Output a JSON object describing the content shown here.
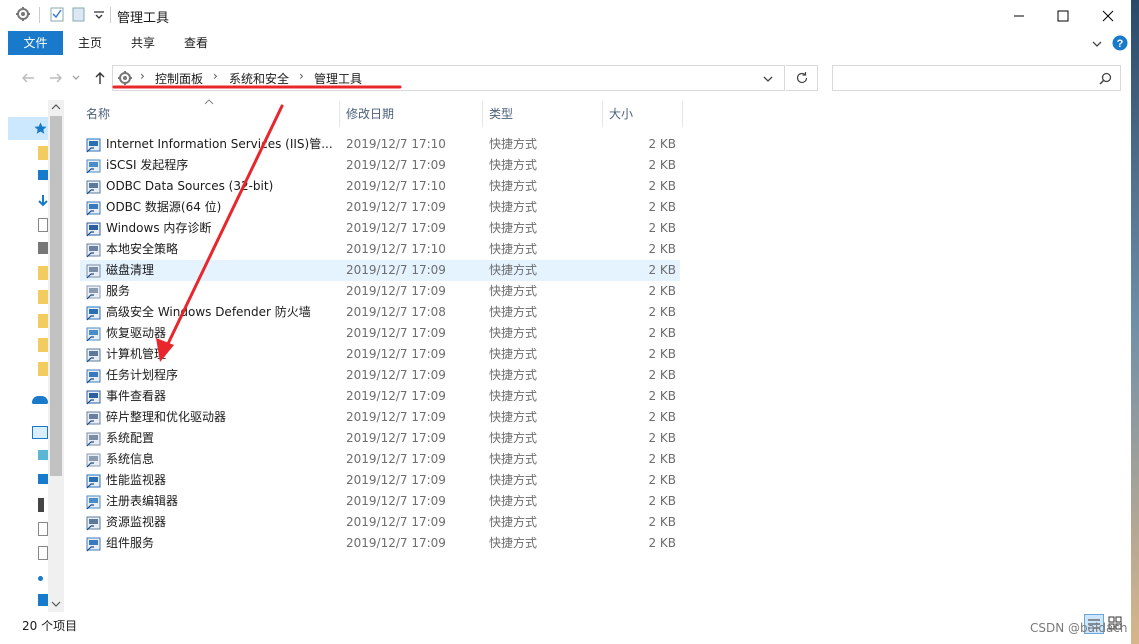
{
  "title_bar": {
    "title": "管理工具"
  },
  "ribbon": {
    "tabs": [
      "文件",
      "主页",
      "共享",
      "查看"
    ]
  },
  "address_bar": {
    "crumbs": [
      "控制面板",
      "系统和安全",
      "管理工具"
    ]
  },
  "search": {
    "placeholder": ""
  },
  "columns": {
    "name": "名称",
    "date": "修改日期",
    "type": "类型",
    "size": "大小"
  },
  "files": [
    {
      "name": "Internet Information Services (IIS)管...",
      "date": "2019/12/7 17:10",
      "type": "快捷方式",
      "size": "2 KB",
      "icon": "iis-manager-icon"
    },
    {
      "name": "iSCSI 发起程序",
      "date": "2019/12/7 17:09",
      "type": "快捷方式",
      "size": "2 KB",
      "icon": "iscsi-icon"
    },
    {
      "name": "ODBC Data Sources (32-bit)",
      "date": "2019/12/7 17:10",
      "type": "快捷方式",
      "size": "2 KB",
      "icon": "odbc-icon"
    },
    {
      "name": "ODBC 数据源(64 位)",
      "date": "2019/12/7 17:09",
      "type": "快捷方式",
      "size": "2 KB",
      "icon": "odbc-icon"
    },
    {
      "name": "Windows 内存诊断",
      "date": "2019/12/7 17:09",
      "type": "快捷方式",
      "size": "2 KB",
      "icon": "memory-diagnostic-icon"
    },
    {
      "name": "本地安全策略",
      "date": "2019/12/7 17:10",
      "type": "快捷方式",
      "size": "2 KB",
      "icon": "security-policy-icon"
    },
    {
      "name": "磁盘清理",
      "date": "2019/12/7 17:09",
      "type": "快捷方式",
      "size": "2 KB",
      "icon": "disk-cleanup-icon"
    },
    {
      "name": "服务",
      "date": "2019/12/7 17:09",
      "type": "快捷方式",
      "size": "2 KB",
      "icon": "services-gear-icon"
    },
    {
      "name": "高级安全 Windows Defender 防火墙",
      "date": "2019/12/7 17:08",
      "type": "快捷方式",
      "size": "2 KB",
      "icon": "firewall-icon"
    },
    {
      "name": "恢复驱动器",
      "date": "2019/12/7 17:09",
      "type": "快捷方式",
      "size": "2 KB",
      "icon": "recovery-drive-icon"
    },
    {
      "name": "计算机管理",
      "date": "2019/12/7 17:09",
      "type": "快捷方式",
      "size": "2 KB",
      "icon": "computer-management-icon"
    },
    {
      "name": "任务计划程序",
      "date": "2019/12/7 17:09",
      "type": "快捷方式",
      "size": "2 KB",
      "icon": "task-scheduler-icon"
    },
    {
      "name": "事件查看器",
      "date": "2019/12/7 17:09",
      "type": "快捷方式",
      "size": "2 KB",
      "icon": "event-viewer-icon"
    },
    {
      "name": "碎片整理和优化驱动器",
      "date": "2019/12/7 17:09",
      "type": "快捷方式",
      "size": "2 KB",
      "icon": "defrag-icon"
    },
    {
      "name": "系统配置",
      "date": "2019/12/7 17:09",
      "type": "快捷方式",
      "size": "2 KB",
      "icon": "system-config-icon"
    },
    {
      "name": "系统信息",
      "date": "2019/12/7 17:09",
      "type": "快捷方式",
      "size": "2 KB",
      "icon": "system-info-icon"
    },
    {
      "name": "性能监视器",
      "date": "2019/12/7 17:09",
      "type": "快捷方式",
      "size": "2 KB",
      "icon": "performance-monitor-icon"
    },
    {
      "name": "注册表编辑器",
      "date": "2019/12/7 17:09",
      "type": "快捷方式",
      "size": "2 KB",
      "icon": "registry-editor-icon"
    },
    {
      "name": "资源监视器",
      "date": "2019/12/7 17:09",
      "type": "快捷方式",
      "size": "2 KB",
      "icon": "resource-monitor-icon"
    },
    {
      "name": "组件服务",
      "date": "2019/12/7 17:09",
      "type": "快捷方式",
      "size": "2 KB",
      "icon": "component-services-icon"
    }
  ],
  "highlighted_row": 6,
  "status_bar": {
    "item_count": "20 个项目"
  },
  "watermark": "CSDN @baidach",
  "colors": {
    "accent": "#1979ca",
    "row_hover": "#e5f3ff",
    "annotation_red": "#e8262b"
  }
}
